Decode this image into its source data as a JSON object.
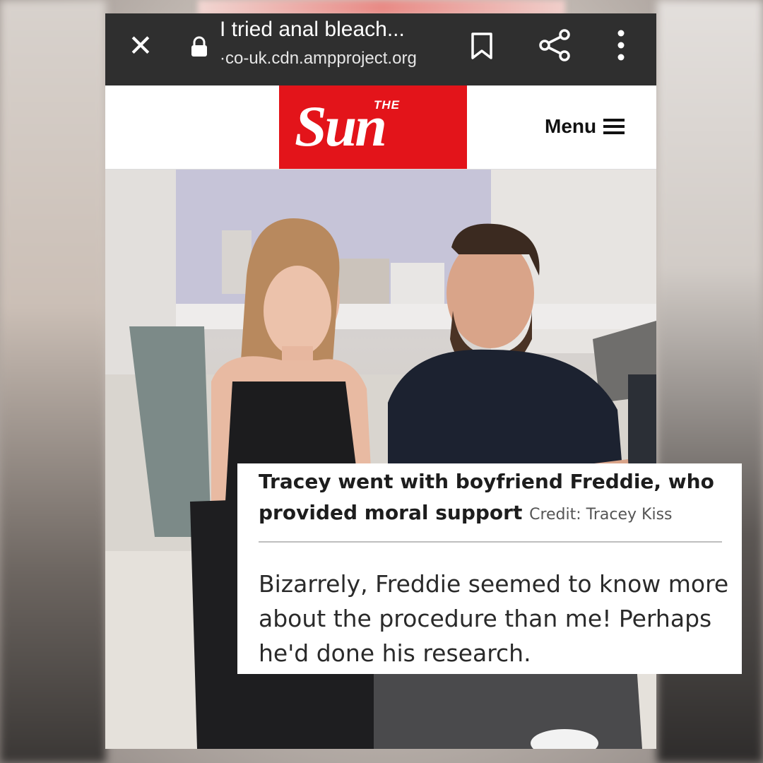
{
  "browser": {
    "close_glyph": "✕",
    "page_title": "I tried anal bleach...",
    "domain": "·co-uk.cdn.ampproject.org",
    "icons": [
      "lock-icon",
      "bookmark-icon",
      "share-icon",
      "more-vert-icon"
    ]
  },
  "site": {
    "logo_the": "THE",
    "logo_word": "Sun",
    "menu_label": "Menu",
    "brand_color": "#e3141a"
  },
  "article": {
    "caption": "Tracey went with boyfriend Freddie, who provided moral support",
    "credit": "Credit: Tracey Kiss",
    "body": "Bizarrely, Freddie seemed to know more about the procedure than me! Perhaps he'd done his research."
  }
}
